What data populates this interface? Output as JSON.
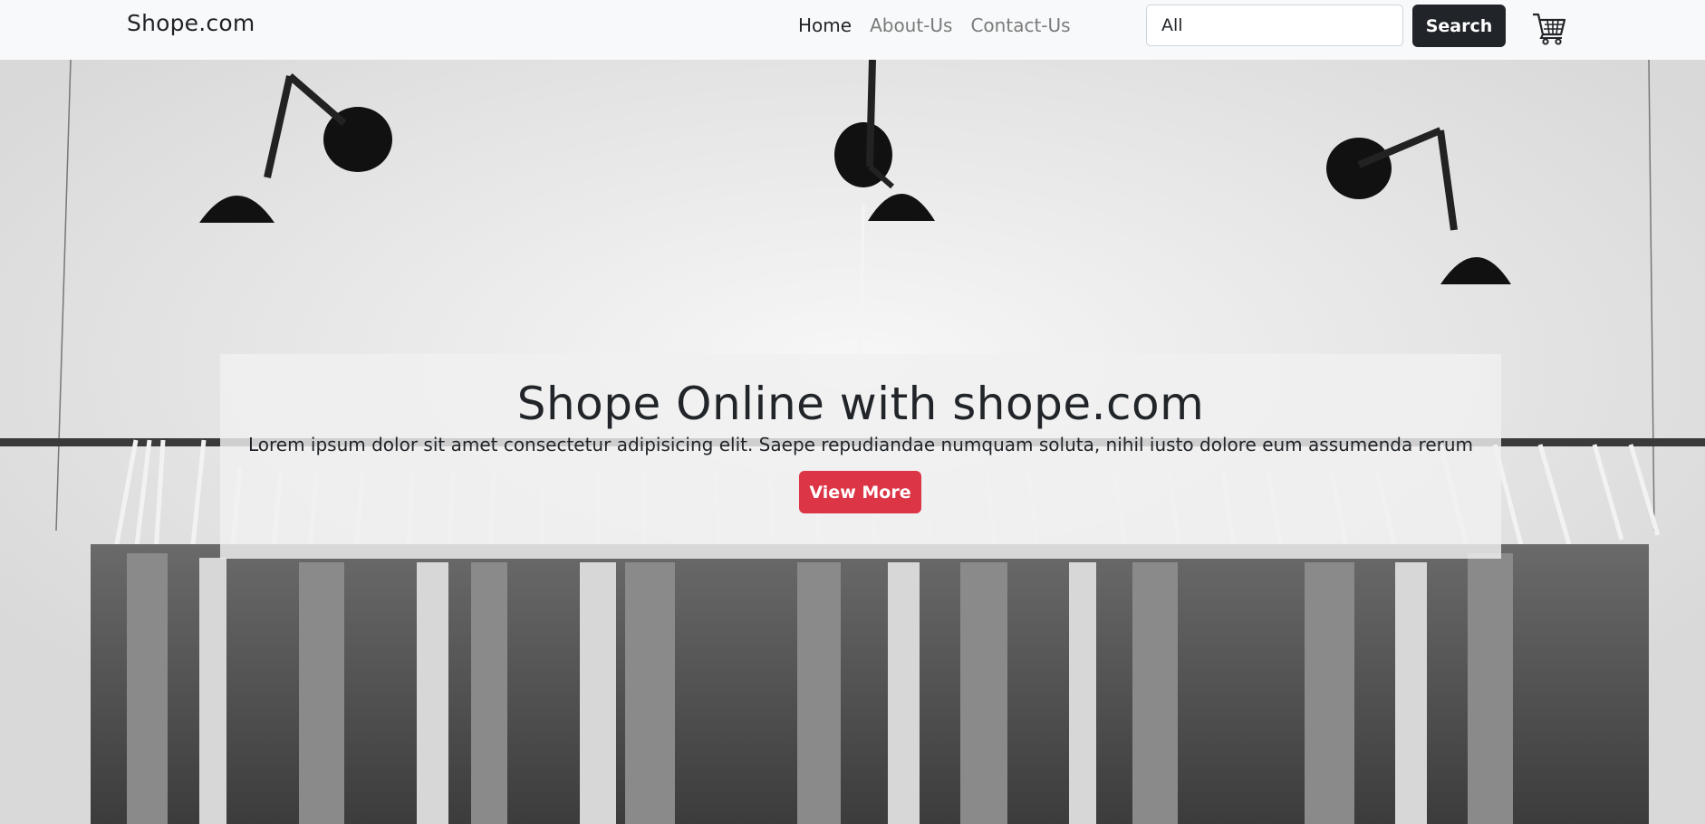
{
  "navbar": {
    "brand": "Shope.com",
    "links": [
      {
        "label": "Home",
        "active": true
      },
      {
        "label": "About-Us",
        "active": false
      },
      {
        "label": "Contact-Us",
        "active": false
      }
    ],
    "search": {
      "value": "All",
      "button_label": "Search"
    },
    "cart_icon": "cart-icon"
  },
  "hero": {
    "title": "Shope Online with shope.com",
    "text": "Lorem ipsum dolor sit amet consectetur adipisicing elit. Saepe repudiandae numquam soluta, nihil iusto dolore eum assumenda rerum",
    "button_label": "View More"
  },
  "colors": {
    "navbar_bg": "#f8f9fa",
    "search_button": "#212529",
    "cta_button": "#dc3545"
  }
}
